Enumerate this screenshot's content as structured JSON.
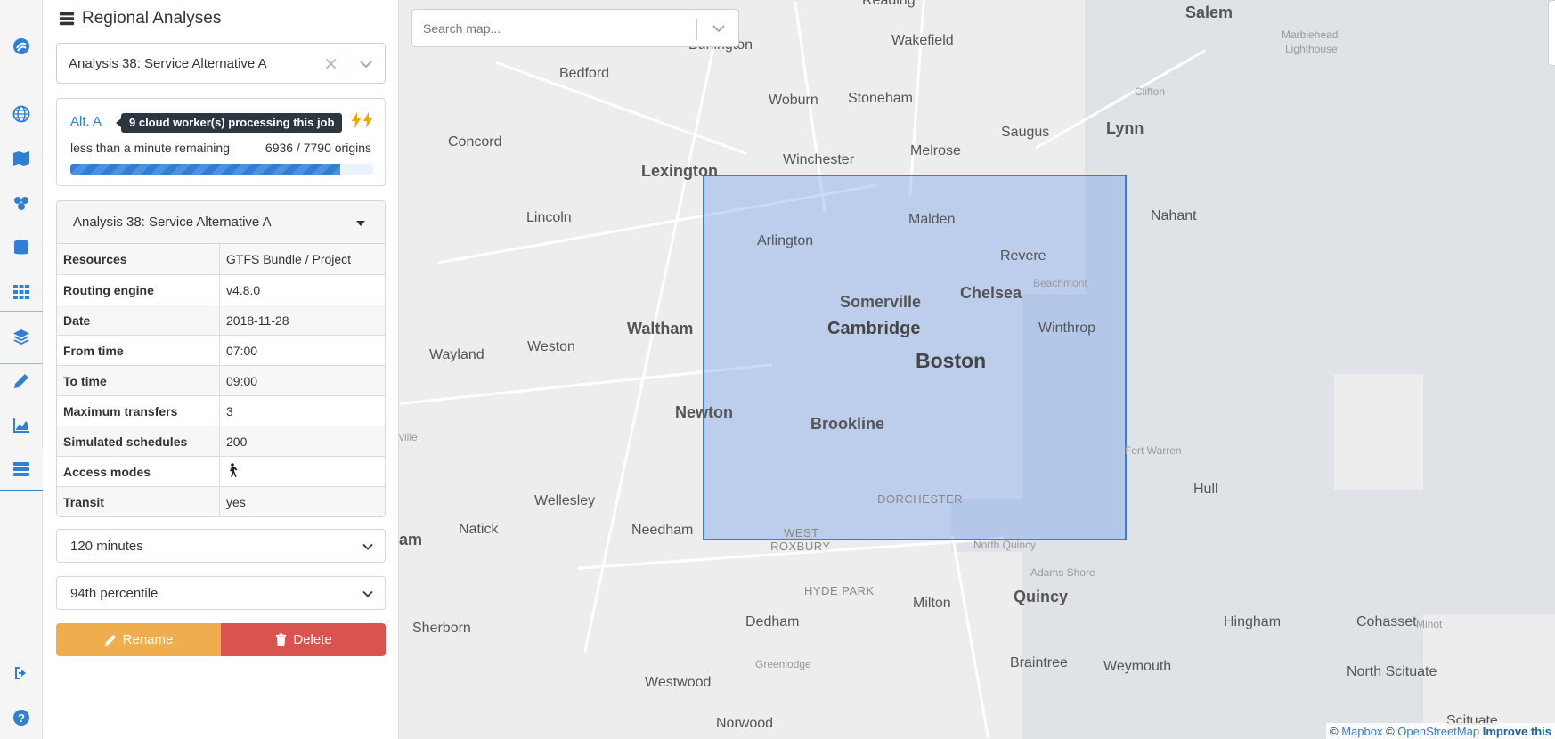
{
  "panel": {
    "title": "Regional Analyses",
    "selected_analysis": "Analysis 38: Service Alternative A"
  },
  "status": {
    "alt_label": "Alt. A",
    "tooltip": "9 cloud worker(s) processing this job",
    "remaining": "less than a minute remaining",
    "origins_text": "6936 / 7790 origins",
    "progress_fraction": 0.89
  },
  "details": {
    "title": "Analysis 38: Service Alternative A",
    "rows": [
      {
        "key": "Resources",
        "value": "GTFS Bundle / Project"
      },
      {
        "key": "Routing engine",
        "value": "v4.8.0"
      },
      {
        "key": "Date",
        "value": "2018-11-28"
      },
      {
        "key": "From time",
        "value": "07:00"
      },
      {
        "key": "To time",
        "value": "09:00"
      },
      {
        "key": "Maximum transfers",
        "value": "3"
      },
      {
        "key": "Simulated schedules",
        "value": "200"
      },
      {
        "key": "Access modes",
        "value": ""
      },
      {
        "key": "Transit",
        "value": "yes"
      }
    ]
  },
  "cutoff": "120 minutes",
  "percentile": "94th percentile",
  "buttons": {
    "rename": "Rename",
    "delete": "Delete"
  },
  "map": {
    "search_placeholder": "Search map...",
    "labels": {
      "reading": "Reading",
      "burlington": "Burlington",
      "wakefield": "Wakefield",
      "salem": "Salem",
      "marblehead": "Marblehead",
      "marblehead2": "Lighthouse",
      "bedford": "Bedford",
      "woburn": "Woburn",
      "stoneham": "Stoneham",
      "clifton": "Clifton",
      "concord": "Concord",
      "saugus": "Saugus",
      "lynn": "Lynn",
      "lexington": "Lexington",
      "winchester": "Winchester",
      "melrose": "Melrose",
      "lincoln": "Lincoln",
      "malden": "Malden",
      "nahant": "Nahant",
      "arlington": "Arlington",
      "revere": "Revere",
      "beachmont": "Beachmont",
      "somerville": "Somerville",
      "chelsea": "Chelsea",
      "waltham": "Waltham",
      "cambridge": "Cambridge",
      "winthrop": "Winthrop",
      "wayland": "Wayland",
      "weston": "Weston",
      "boston": "Boston",
      "newton": "Newton",
      "brookline": "Brookline",
      "fortwarren": "Fort Warren",
      "ville": "ville",
      "hull": "Hull",
      "wellesley": "Wellesley",
      "dorchester": "DORCHESTER",
      "natick": "Natick",
      "needham": "Needham",
      "west": "WEST",
      "roxbury": "ROXBURY",
      "northquincy": "North Quincy",
      "am": "am",
      "adamsshore": "Adams Shore",
      "hydepark": "HYDE PARK",
      "quincy": "Quincy",
      "sherborn": "Sherborn",
      "milton": "Milton",
      "dedham": "Dedham",
      "hingham": "Hingham",
      "cohasset": "Cohasset",
      "minot": "Minot",
      "greenlodge": "Greenlodge",
      "braintree": "Braintree",
      "weymouth": "Weymouth",
      "northscituate": "North Scituate",
      "westwood": "Westwood",
      "norwood": "Norwood",
      "scituate": "Scituate"
    },
    "attribution": {
      "prefix": "©",
      "mapbox": "Mapbox",
      "mid": "©",
      "osm": "OpenStreetMap",
      "improve": "Improve this"
    }
  }
}
